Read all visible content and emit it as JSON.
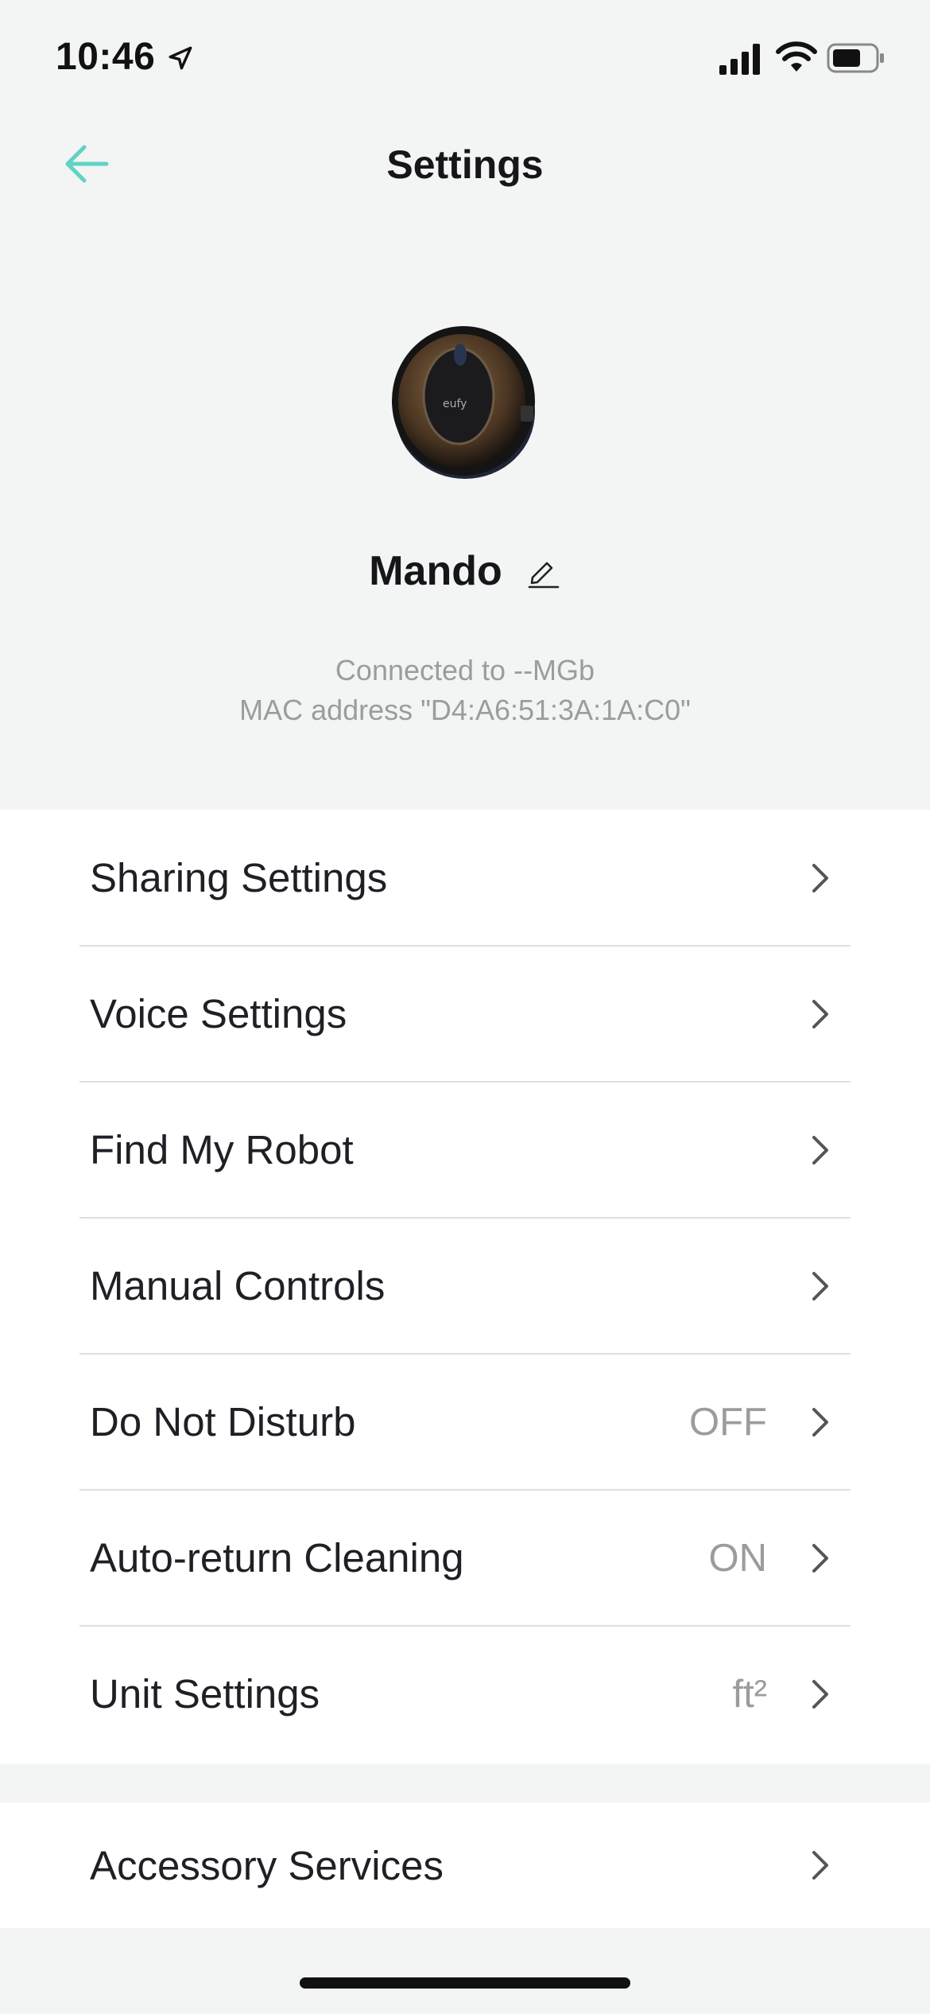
{
  "status_bar": {
    "time": "10:46",
    "icons": [
      "location-arrow-icon",
      "signal-icon",
      "wifi-icon",
      "battery-icon"
    ]
  },
  "header": {
    "title": "Settings",
    "back_icon": "arrow-left-icon"
  },
  "device": {
    "name": "Mando",
    "brand_mark": "eufy",
    "connection_line": "Connected to --MGb",
    "mac_line": "MAC address \"D4:A6:51:3A:1A:C0\""
  },
  "settings": {
    "items": [
      {
        "label": "Sharing Settings",
        "value": ""
      },
      {
        "label": "Voice Settings",
        "value": ""
      },
      {
        "label": "Find My Robot",
        "value": ""
      },
      {
        "label": "Manual Controls",
        "value": ""
      },
      {
        "label": "Do Not Disturb",
        "value": "OFF"
      },
      {
        "label": "Auto-return Cleaning",
        "value": "ON"
      },
      {
        "label": "Unit Settings",
        "value": "ft²"
      }
    ],
    "accessory": {
      "label": "Accessory Services"
    }
  },
  "colors": {
    "accent": "#5fd3c4",
    "background": "#f3f4f4",
    "list_background": "#ffffff",
    "secondary_text": "#9a9c9e"
  }
}
